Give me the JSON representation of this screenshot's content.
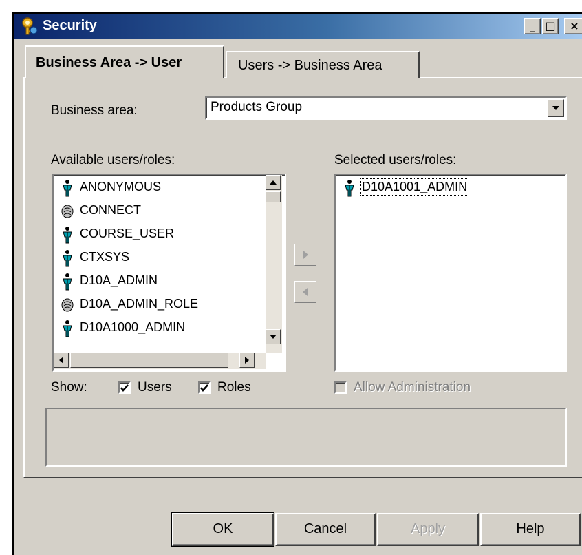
{
  "window": {
    "title": "Security",
    "minimize_glyph": "_",
    "maximize_glyph": "□",
    "close_glyph": "×"
  },
  "tabs": [
    {
      "label": "Business Area -> User",
      "active": true
    },
    {
      "label": "Users -> Business Area",
      "active": false
    }
  ],
  "business_area": {
    "label": "Business area:",
    "value": "Products Group"
  },
  "available": {
    "label": "Available users/roles:",
    "items": [
      {
        "label": "ANONYMOUS",
        "icon": "user-icon"
      },
      {
        "label": "CONNECT",
        "icon": "role-icon"
      },
      {
        "label": "COURSE_USER",
        "icon": "user-icon"
      },
      {
        "label": "CTXSYS",
        "icon": "user-icon"
      },
      {
        "label": "D10A_ADMIN",
        "icon": "user-icon"
      },
      {
        "label": "D10A_ADMIN_ROLE",
        "icon": "role-icon"
      },
      {
        "label": "D10A1000_ADMIN",
        "icon": "user-icon"
      }
    ]
  },
  "selected": {
    "label": "Selected users/roles:",
    "items": [
      {
        "label": "D10A1001_ADMIN",
        "icon": "user-icon"
      }
    ]
  },
  "show": {
    "label": "Show:",
    "users_label": "Users",
    "users_checked": true,
    "roles_label": "Roles",
    "roles_checked": true
  },
  "allow_admin": {
    "label": "Allow Administration",
    "checked": false,
    "enabled": false
  },
  "buttons": {
    "ok": "OK",
    "cancel": "Cancel",
    "apply": "Apply",
    "help": "Help"
  },
  "colors": {
    "title_start": "#0a246a",
    "title_end": "#a6caf0",
    "face": "#d4d0c8",
    "user_icon": "#00a0b0"
  }
}
